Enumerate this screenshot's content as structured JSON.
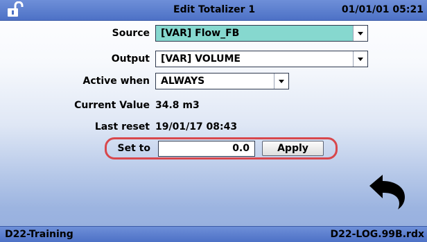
{
  "header": {
    "title": "Edit Totalizer 1",
    "datetime": "01/01/01 05:21",
    "lock_icon": "unlocked-padlock-icon"
  },
  "form": {
    "source": {
      "label": "Source",
      "value": "[VAR] Flow_FB"
    },
    "output": {
      "label": "Output",
      "value": "[VAR] VOLUME"
    },
    "active_when": {
      "label": "Active when",
      "value": "ALWAYS"
    },
    "current_value": {
      "label": "Current Value",
      "value": "34.8 m3"
    },
    "last_reset": {
      "label": "Last reset",
      "value": "19/01/17 08:43"
    },
    "set_to": {
      "label": "Set to",
      "value": "0.0"
    },
    "apply_label": "Apply"
  },
  "back_icon": "back-arrow-icon",
  "footer": {
    "left": "D22-Training",
    "right": "D22-LOG.99B.rdx"
  },
  "colors": {
    "bar": "#5a7dcc",
    "selected_field": "#86d8cf",
    "highlight_ring": "#d8474c"
  }
}
